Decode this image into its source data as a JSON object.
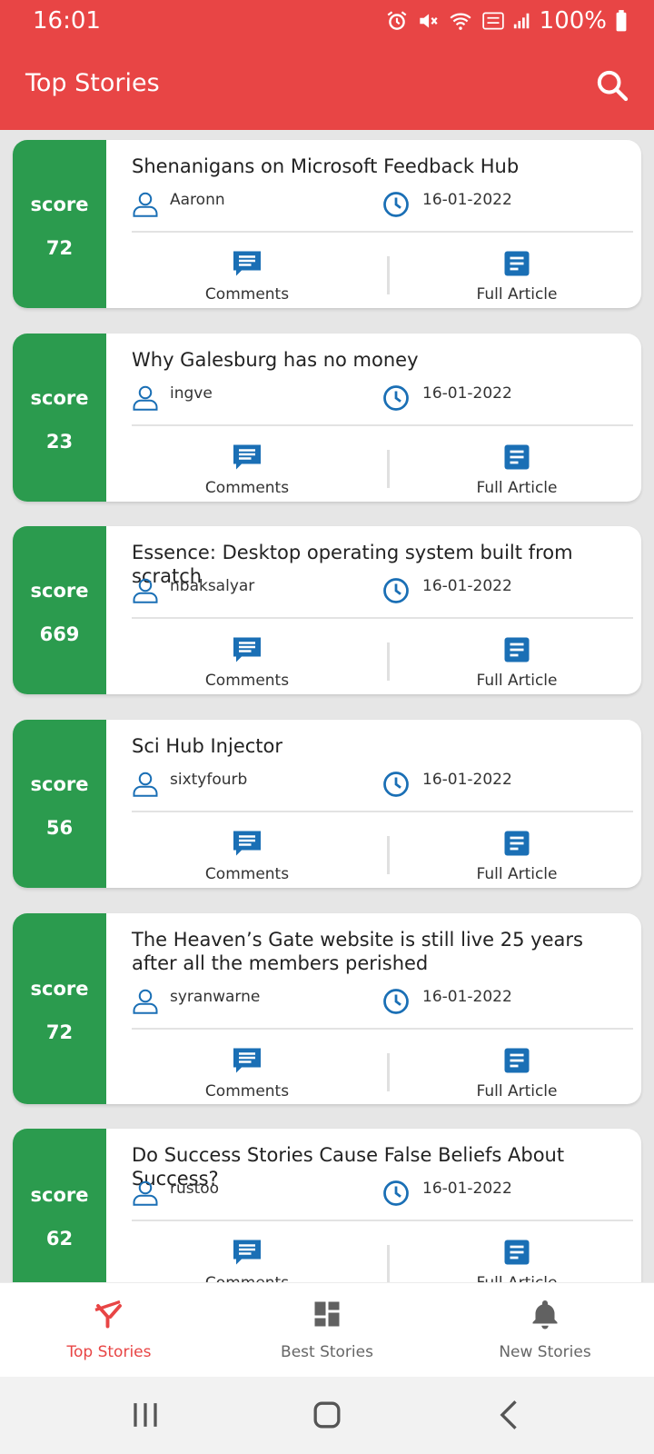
{
  "status_bar": {
    "time": "16:01",
    "battery": "100%"
  },
  "app_bar": {
    "title": "Top Stories"
  },
  "labels": {
    "score": "score",
    "comments": "Comments",
    "full_article": "Full Article"
  },
  "stories": [
    {
      "score": "72",
      "title": "Shenanigans on Microsoft Feedback Hub",
      "author": "Aaronn",
      "date": "16-01-2022"
    },
    {
      "score": "23",
      "title": "Why Galesburg has no money",
      "author": "ingve",
      "date": "16-01-2022"
    },
    {
      "score": "669",
      "title": "Essence: Desktop operating system built from scratch",
      "author": "nbaksalyar",
      "date": "16-01-2022"
    },
    {
      "score": "56",
      "title": "Sci Hub Injector",
      "author": "sixtyfourb",
      "date": "16-01-2022"
    },
    {
      "score": "72",
      "title": "The Heaven’s Gate website is still live 25 years after all the members perished",
      "author": "syranwarne",
      "date": "16-01-2022"
    },
    {
      "score": "62",
      "title": "Do Success Stories Cause False Beliefs About Success?",
      "author": "rustoo",
      "date": "16-01-2022"
    }
  ],
  "bottom_nav": {
    "items": [
      {
        "label": "Top Stories",
        "icon": "top-stories-icon",
        "active": true
      },
      {
        "label": "Best Stories",
        "icon": "dashboard-icon",
        "active": false
      },
      {
        "label": "New Stories",
        "icon": "bell-icon",
        "active": false
      }
    ]
  },
  "colors": {
    "header": "#e84545",
    "score_panel": "#2b9b4e",
    "icon_blue": "#1a6fb5",
    "active_nav": "#e84545"
  }
}
